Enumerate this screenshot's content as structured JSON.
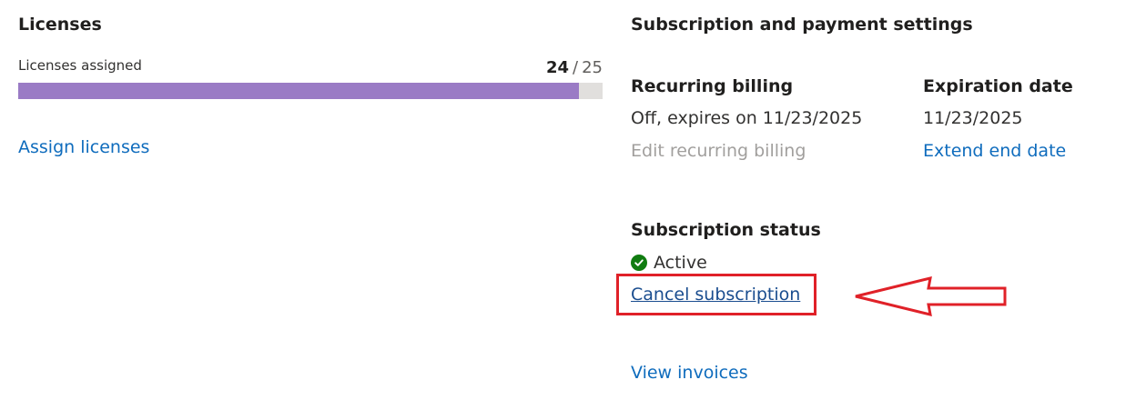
{
  "licenses": {
    "title": "Licenses",
    "assigned_label": "Licenses assigned",
    "assigned": "24",
    "separator": "/",
    "total": "25",
    "usage_fraction": 0.96,
    "assign_link": "Assign licenses"
  },
  "subscription": {
    "title": "Subscription and payment settings",
    "recurring_billing": {
      "heading": "Recurring billing",
      "value": "Off, expires on 11/23/2025",
      "edit_link": "Edit recurring billing"
    },
    "expiration": {
      "heading": "Expiration date",
      "value": "11/23/2025",
      "extend_link": "Extend end date"
    },
    "status": {
      "heading": "Subscription status",
      "value": "Active",
      "icon": "check-circle-icon",
      "cancel_link": "Cancel subscription"
    },
    "invoices_link": "View invoices"
  },
  "colors": {
    "link": "#0f6cbd",
    "progress_fill": "#9a7bc5",
    "status_active": "#107c10",
    "annotation": "#e02128"
  }
}
